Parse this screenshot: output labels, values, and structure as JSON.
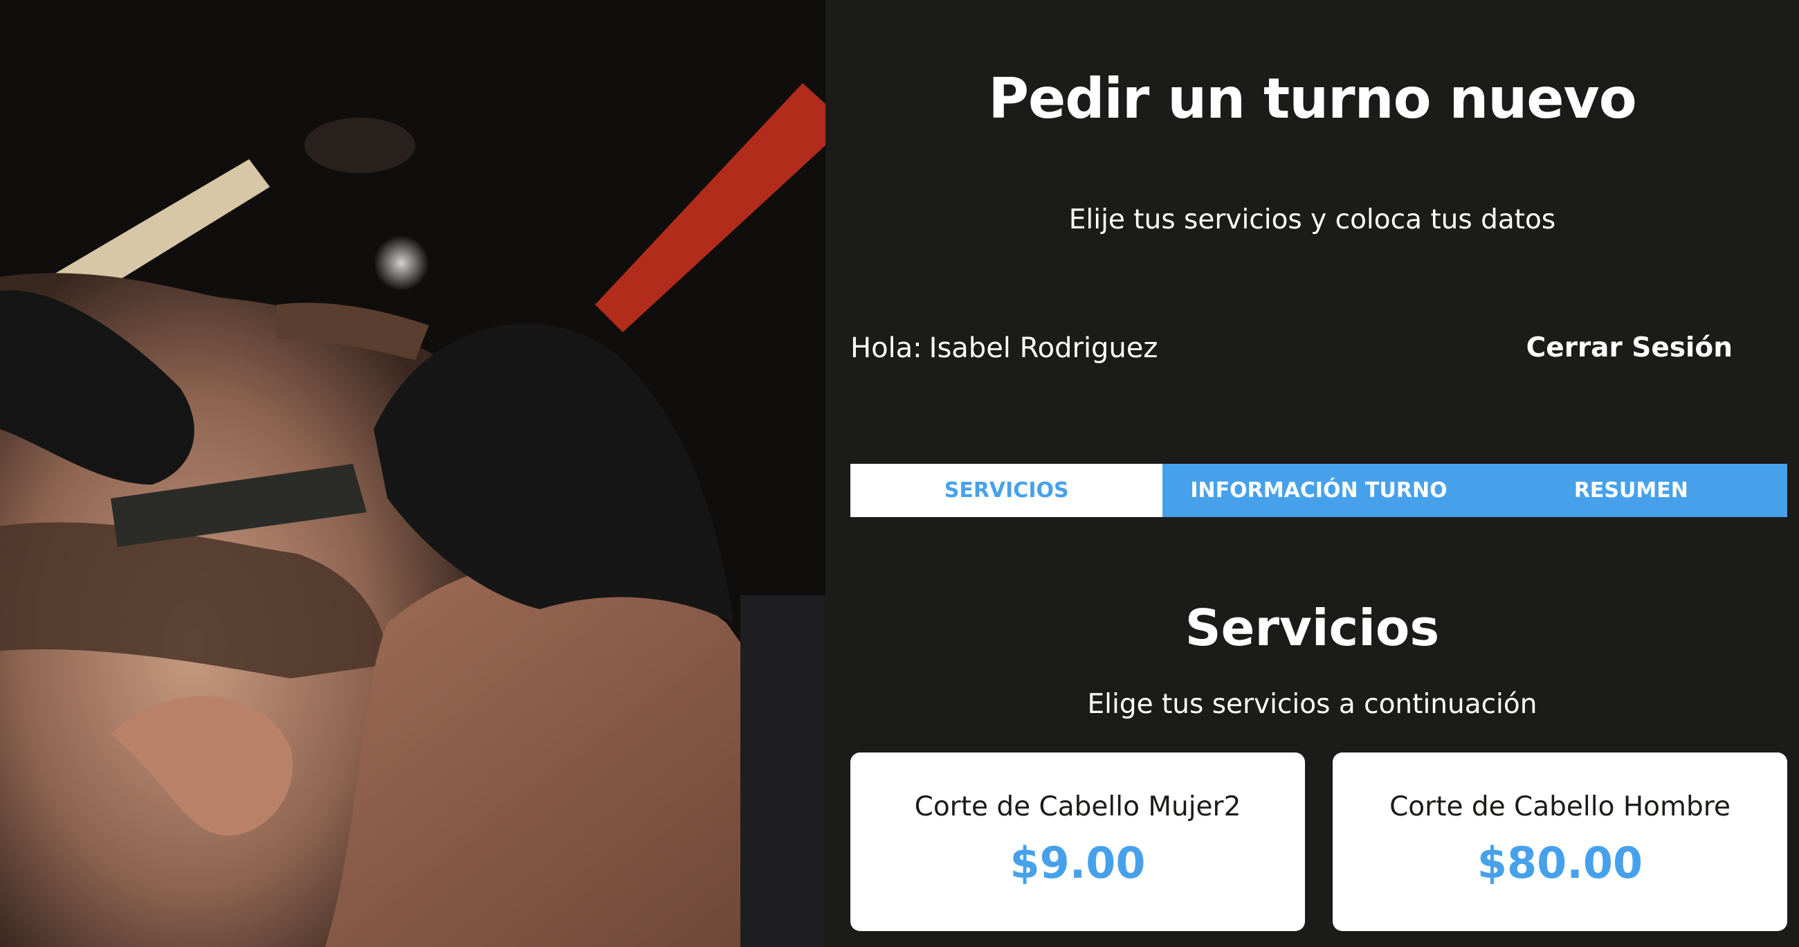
{
  "hero": {
    "image_icon": "barber-shaving-photo"
  },
  "header": {
    "title": "Pedir un turno nuevo",
    "subtitle": "Elije tus servicios y coloca tus datos"
  },
  "user": {
    "greeting_label": "Hola:",
    "name": "Isabel Rodriguez",
    "logout_label": "Cerrar Sesión"
  },
  "tabs": [
    {
      "label": "Servicios",
      "active": true
    },
    {
      "label": "Información Turno",
      "active": false
    },
    {
      "label": "Resumen",
      "active": false
    }
  ],
  "services": {
    "title": "Servicios",
    "subtitle": "Elige tus servicios a continuación",
    "items": [
      {
        "name": "Corte de Cabello Mujer2",
        "price": "$9.00"
      },
      {
        "name": "Corte de Cabello Hombre",
        "price": "$80.00"
      }
    ]
  },
  "colors": {
    "accent": "#47a1ea",
    "background": "#1b1b19",
    "card": "#ffffff"
  }
}
